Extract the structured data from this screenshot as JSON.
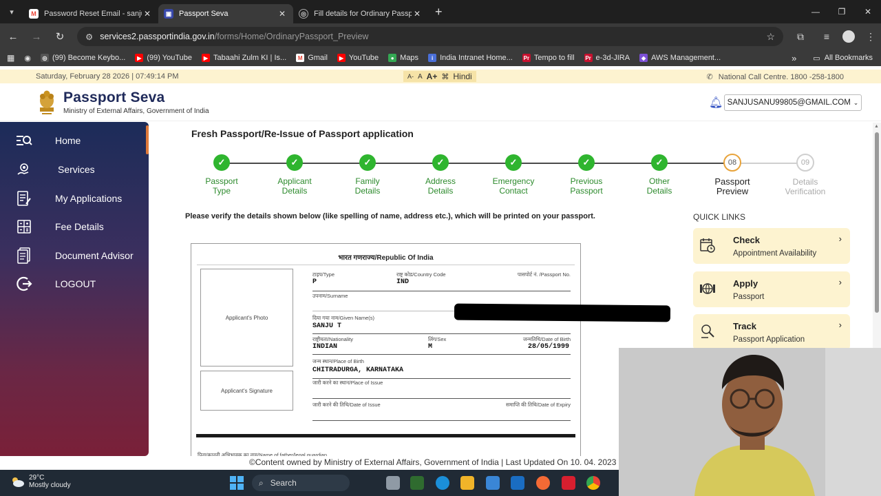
{
  "browser": {
    "tabs": [
      {
        "title": "Password Reset Email - sanjusa",
        "favicon": "gmail-icon",
        "active": false
      },
      {
        "title": "Passport Seva",
        "favicon": "passport-seva-icon",
        "active": true
      },
      {
        "title": "Fill details for Ordinary Passpor",
        "favicon": "globe-icon",
        "active": false
      }
    ],
    "url_host": "services2.passportindia.gov.in",
    "url_path": "/forms/Home/OrdinaryPassport_Preview",
    "bookmarks": [
      {
        "label": "(99) Become Keybo...",
        "color": "#e0e0e0"
      },
      {
        "label": "(99) YouTube",
        "color": "#ff0000"
      },
      {
        "label": "Tabaahi Zulm KI | Is...",
        "color": "#ff0000"
      },
      {
        "label": "Gmail",
        "color": "#ea4335"
      },
      {
        "label": "YouTube",
        "color": "#ff0000"
      },
      {
        "label": "Maps",
        "color": "#34a853"
      },
      {
        "label": "India Intranet Home...",
        "color": "#4a6fd8"
      },
      {
        "label": "Tempo to fill",
        "color": "#c8102e"
      },
      {
        "label": "e-3d-JIRA",
        "color": "#c8102e"
      },
      {
        "label": "AWS Management...",
        "color": "#7b4fd6"
      }
    ],
    "all_bookmarks": "All Bookmarks",
    "more_bookmarks": "»"
  },
  "topstrip": {
    "datetime": "Saturday, February 28 2026 | 07:49:14 PM",
    "font_controls": [
      "A-",
      "A",
      "A+"
    ],
    "hindi": "Hindi",
    "call_centre": "National Call Centre. 1800 -258-1800"
  },
  "header": {
    "brand": "Passport Seva",
    "subtitle": "Ministry of External Affairs, Government of India",
    "user_email": "SANJUSANU99805@GMAIL.COM"
  },
  "sidebar": {
    "items": [
      {
        "label": "Home",
        "icon": "search-list-icon"
      },
      {
        "label": "Services",
        "icon": "gear-hand-icon"
      },
      {
        "label": "My Applications",
        "icon": "document-pen-icon"
      },
      {
        "label": "Fee Details",
        "icon": "calculator-icon"
      },
      {
        "label": "Document Advisor",
        "icon": "documents-icon"
      },
      {
        "label": "LOGOUT",
        "icon": "logout-icon"
      }
    ]
  },
  "main": {
    "title": "Fresh Passport/Re-Issue of Passport application",
    "steps": [
      {
        "line1": "Passport",
        "line2": "Type",
        "state": "done"
      },
      {
        "line1": "Applicant",
        "line2": "Details",
        "state": "done"
      },
      {
        "line1": "Family",
        "line2": "Details",
        "state": "done"
      },
      {
        "line1": "Address",
        "line2": "Details",
        "state": "done"
      },
      {
        "line1": "Emergency",
        "line2": "Contact",
        "state": "done"
      },
      {
        "line1": "Previous",
        "line2": "Passport",
        "state": "done"
      },
      {
        "line1": "Other",
        "line2": "Details",
        "state": "done"
      },
      {
        "line1": "Passport",
        "line2": "Preview",
        "state": "current",
        "number": "08"
      },
      {
        "line1": "Details",
        "line2": "Verification",
        "state": "future",
        "number": "09"
      }
    ],
    "verify_message": "Please verify the details shown below (like spelling of name, address etc.), which will be printed on your passport."
  },
  "passport": {
    "heading": "भारत गणराज्य/Republic Of India",
    "photo_label": "Applicant's Photo",
    "signature_label": "Applicant's Signature",
    "type_label": "टाइप/Type",
    "type_value": "P",
    "country_code_label": "राष्ट्र कोड/Country Code",
    "country_code_value": "IND",
    "passport_no_label": "पासपोर्ट नं. /Passport No.",
    "surname_label": "उपनाम/Surname",
    "given_name_label": "दिया गया नाम/Given Name(s)",
    "given_name_value": "SANJU T",
    "nationality_label": "राष्ट्रीयता/Nationality",
    "nationality_value": "INDIAN",
    "sex_label": "लिंग/Sex",
    "sex_value": "M",
    "dob_label": "जन्मतिथि/Date of Birth",
    "dob_value": "28/05/1999",
    "pob_label": "जन्म स्थान/Place of Birth",
    "pob_value": "CHITRADURGA, KARNATAKA",
    "poi_label": "जारी करने का स्थान/Place of Issue",
    "doi_label": "जारी करने की तिथि/Date of Issue",
    "doe_label": "समाप्ति की तिथि/Date of Expiry",
    "father_label": "पिता/कानूनी अभिभावक का नाम/Name of father/legal guardian"
  },
  "quick_links": {
    "title": "QUICK LINKS",
    "cards": [
      {
        "line1": "Check",
        "line2": "Appointment Availability",
        "icon": "calendar-clock-icon"
      },
      {
        "line1": "Apply",
        "line2": "Passport",
        "icon": "globe-passport-icon"
      },
      {
        "line1": "Track",
        "line2": "Passport Application",
        "icon": "track-search-icon"
      }
    ]
  },
  "footer": {
    "text": "©Content owned by Ministry of External Affairs, Government of India  |  Last Updated On 10. 04. 2023"
  },
  "taskbar": {
    "temperature": "29°C",
    "weather": "Mostly cloudy",
    "search": "Search"
  }
}
